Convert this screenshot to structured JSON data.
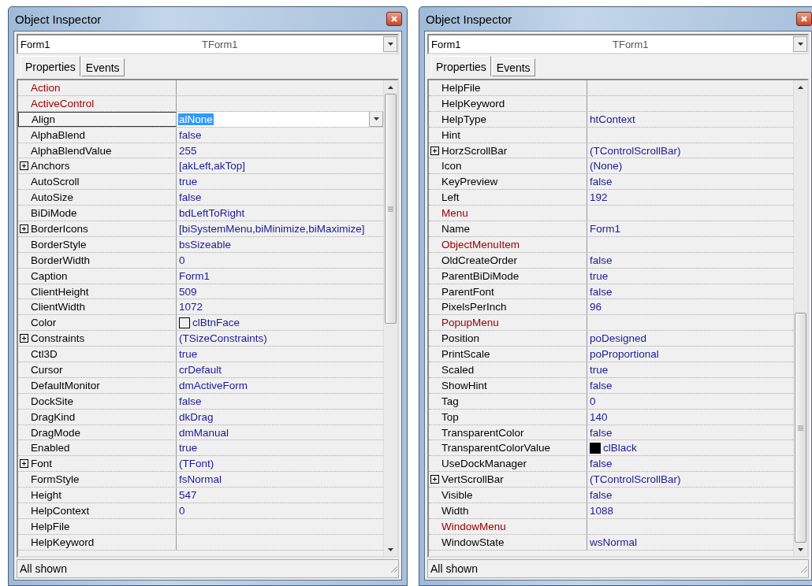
{
  "windows": [
    {
      "title": "Object Inspector",
      "object": {
        "name": "Form1",
        "type": "TForm1"
      },
      "tabs": [
        {
          "label": "Properties",
          "selected": true
        },
        {
          "label": "Events",
          "selected": false
        }
      ],
      "status": "All shown",
      "rows": [
        {
          "name": "Action",
          "value": "",
          "kind": "reference",
          "selected": false
        },
        {
          "name": "ActiveControl",
          "value": "",
          "kind": "reference",
          "selected": false
        },
        {
          "name": "Align",
          "value": "alNone",
          "kind": "plain",
          "selected": true
        },
        {
          "name": "AlphaBlend",
          "value": "false",
          "kind": "plain",
          "selected": false
        },
        {
          "name": "AlphaBlendValue",
          "value": "255",
          "kind": "plain",
          "selected": false
        },
        {
          "name": "Anchors",
          "value": "[akLeft,akTop]",
          "kind": "expandable",
          "selected": false
        },
        {
          "name": "AutoScroll",
          "value": "true",
          "kind": "plain",
          "selected": false
        },
        {
          "name": "AutoSize",
          "value": "false",
          "kind": "plain",
          "selected": false
        },
        {
          "name": "BiDiMode",
          "value": "bdLeftToRight",
          "kind": "plain",
          "selected": false
        },
        {
          "name": "BorderIcons",
          "value": "[biSystemMenu,biMinimize,biMaximize]",
          "kind": "expandable",
          "selected": false
        },
        {
          "name": "BorderStyle",
          "value": "bsSizeable",
          "kind": "plain",
          "selected": false
        },
        {
          "name": "BorderWidth",
          "value": "0",
          "kind": "plain",
          "selected": false
        },
        {
          "name": "Caption",
          "value": "Form1",
          "kind": "plain",
          "selected": false
        },
        {
          "name": "ClientHeight",
          "value": "509",
          "kind": "plain",
          "selected": false
        },
        {
          "name": "ClientWidth",
          "value": "1072",
          "kind": "plain",
          "selected": false
        },
        {
          "name": "Color",
          "value": "clBtnFace",
          "kind": "color",
          "color": "#f0f0f0",
          "selected": false
        },
        {
          "name": "Constraints",
          "value": "(TSizeConstraints)",
          "kind": "expandable",
          "selected": false
        },
        {
          "name": "Ctl3D",
          "value": "true",
          "kind": "plain",
          "selected": false
        },
        {
          "name": "Cursor",
          "value": "crDefault",
          "kind": "plain",
          "selected": false
        },
        {
          "name": "DefaultMonitor",
          "value": "dmActiveForm",
          "kind": "plain",
          "selected": false
        },
        {
          "name": "DockSite",
          "value": "false",
          "kind": "plain",
          "selected": false
        },
        {
          "name": "DragKind",
          "value": "dkDrag",
          "kind": "plain",
          "selected": false
        },
        {
          "name": "DragMode",
          "value": "dmManual",
          "kind": "plain",
          "selected": false
        },
        {
          "name": "Enabled",
          "value": "true",
          "kind": "plain",
          "selected": false
        },
        {
          "name": "Font",
          "value": "(TFont)",
          "kind": "expandable",
          "selected": false
        },
        {
          "name": "FormStyle",
          "value": "fsNormal",
          "kind": "plain",
          "selected": false
        },
        {
          "name": "Height",
          "value": "547",
          "kind": "plain",
          "selected": false
        },
        {
          "name": "HelpContext",
          "value": "0",
          "kind": "plain",
          "selected": false
        },
        {
          "name": "HelpFile",
          "value": "",
          "kind": "plain",
          "selected": false
        },
        {
          "name": "HelpKeyword",
          "value": "",
          "kind": "plain",
          "selected": false
        }
      ]
    },
    {
      "title": "Object Inspector",
      "object": {
        "name": "Form1",
        "type": "TForm1"
      },
      "tabs": [
        {
          "label": "Properties",
          "selected": true
        },
        {
          "label": "Events",
          "selected": false
        }
      ],
      "status": "All shown",
      "rows": [
        {
          "name": "HelpFile",
          "value": "",
          "kind": "plain",
          "selected": false
        },
        {
          "name": "HelpKeyword",
          "value": "",
          "kind": "plain",
          "selected": false
        },
        {
          "name": "HelpType",
          "value": "htContext",
          "kind": "plain",
          "selected": false
        },
        {
          "name": "Hint",
          "value": "",
          "kind": "plain",
          "selected": false
        },
        {
          "name": "HorzScrollBar",
          "value": "(TControlScrollBar)",
          "kind": "expandable",
          "selected": false
        },
        {
          "name": "Icon",
          "value": "(None)",
          "kind": "plain",
          "selected": false
        },
        {
          "name": "KeyPreview",
          "value": "false",
          "kind": "plain",
          "selected": false
        },
        {
          "name": "Left",
          "value": "192",
          "kind": "plain",
          "selected": false
        },
        {
          "name": "Menu",
          "value": "",
          "kind": "reference",
          "selected": false
        },
        {
          "name": "Name",
          "value": "Form1",
          "kind": "plain",
          "selected": false
        },
        {
          "name": "ObjectMenuItem",
          "value": "",
          "kind": "reference",
          "selected": false
        },
        {
          "name": "OldCreateOrder",
          "value": "false",
          "kind": "plain",
          "selected": false
        },
        {
          "name": "ParentBiDiMode",
          "value": "true",
          "kind": "plain",
          "selected": false
        },
        {
          "name": "ParentFont",
          "value": "false",
          "kind": "plain",
          "selected": false
        },
        {
          "name": "PixelsPerInch",
          "value": "96",
          "kind": "plain",
          "selected": false
        },
        {
          "name": "PopupMenu",
          "value": "",
          "kind": "reference",
          "selected": false
        },
        {
          "name": "Position",
          "value": "poDesigned",
          "kind": "plain",
          "selected": false
        },
        {
          "name": "PrintScale",
          "value": "poProportional",
          "kind": "plain",
          "selected": false
        },
        {
          "name": "Scaled",
          "value": "true",
          "kind": "plain",
          "selected": false
        },
        {
          "name": "ShowHint",
          "value": "false",
          "kind": "plain",
          "selected": false
        },
        {
          "name": "Tag",
          "value": "0",
          "kind": "plain",
          "selected": false
        },
        {
          "name": "Top",
          "value": "140",
          "kind": "plain",
          "selected": false
        },
        {
          "name": "TransparentColor",
          "value": "false",
          "kind": "plain",
          "selected": false
        },
        {
          "name": "TransparentColorValue",
          "value": "clBlack",
          "kind": "color",
          "color": "#000000",
          "selected": false
        },
        {
          "name": "UseDockManager",
          "value": "false",
          "kind": "plain",
          "selected": false
        },
        {
          "name": "VertScrollBar",
          "value": "(TControlScrollBar)",
          "kind": "expandable",
          "selected": false
        },
        {
          "name": "Visible",
          "value": "false",
          "kind": "plain",
          "selected": false
        },
        {
          "name": "Width",
          "value": "1088",
          "kind": "plain",
          "selected": false
        },
        {
          "name": "WindowMenu",
          "value": "",
          "kind": "reference",
          "selected": false
        },
        {
          "name": "WindowState",
          "value": "wsNormal",
          "kind": "plain",
          "selected": false
        }
      ]
    }
  ]
}
